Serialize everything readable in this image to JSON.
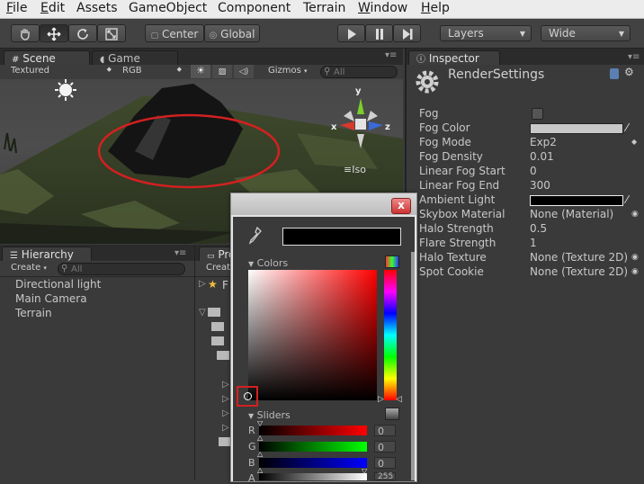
{
  "menu": [
    "File",
    "Edit",
    "Assets",
    "GameObject",
    "Component",
    "Terrain",
    "Window",
    "Help"
  ],
  "menu_underline": [
    "F",
    "E",
    "",
    "",
    "",
    "",
    "W",
    "H"
  ],
  "menu_rest": [
    "ile",
    "dit",
    "Assets",
    "GameObject",
    "Component",
    "Terrain",
    "indow",
    "elp"
  ],
  "toolbar": {
    "pivot_label": "Center",
    "space_label": "Global",
    "layers_label": "Layers",
    "layout_label": "Wide"
  },
  "scene": {
    "tab_label": "Scene",
    "game_tab_label": "Game",
    "draw_mode": "Textured",
    "render_mode": "RGB",
    "gizmos_label": "Gizmos",
    "search_placeholder": "All",
    "iso_label": "Iso",
    "gizmo_axes": {
      "y": "y",
      "x": "x",
      "z": "z"
    }
  },
  "hierarchy": {
    "tab_label": "Hierarchy",
    "create_label": "Create",
    "search_placeholder": "All",
    "items": [
      "Directional light",
      "Main Camera",
      "Terrain"
    ]
  },
  "project": {
    "tab_label": "Pro",
    "create_label": "Creat",
    "first_item_label": "F"
  },
  "inspector": {
    "tab_label": "Inspector",
    "object_name": "RenderSettings",
    "properties": [
      {
        "label": "Fog",
        "value": ""
      },
      {
        "label": "Fog Color",
        "value": ""
      },
      {
        "label": "Fog Mode",
        "value": "Exp2"
      },
      {
        "label": "Fog Density",
        "value": "0.01"
      },
      {
        "label": "Linear Fog Start",
        "value": "0"
      },
      {
        "label": "Linear Fog End",
        "value": "300"
      },
      {
        "label": "Ambient Light",
        "value": ""
      },
      {
        "label": "Skybox Material",
        "value": "None (Material)"
      },
      {
        "label": "Halo Strength",
        "value": "0.5"
      },
      {
        "label": "Flare Strength",
        "value": "1"
      },
      {
        "label": "Halo Texture",
        "value": "None (Texture 2D)"
      },
      {
        "label": "Spot Cookie",
        "value": "None (Texture 2D)"
      }
    ],
    "fog_enabled": false,
    "fog_color_hex": "#c8c8c8",
    "ambient_light_hex": "#000000"
  },
  "color_picker": {
    "close_glyph": "x",
    "current_color_hex": "#000000",
    "colors_section_label": "Colors",
    "hue_hex": "#ff0000",
    "sliders_section_label": "Sliders",
    "sliders": [
      {
        "label": "R",
        "value": "0"
      },
      {
        "label": "G",
        "value": "0"
      },
      {
        "label": "B",
        "value": "0"
      },
      {
        "label": "A",
        "value": "255"
      }
    ]
  },
  "colors": {
    "highlight_red": "#d42020",
    "window_bg": "#3a3a3a"
  }
}
